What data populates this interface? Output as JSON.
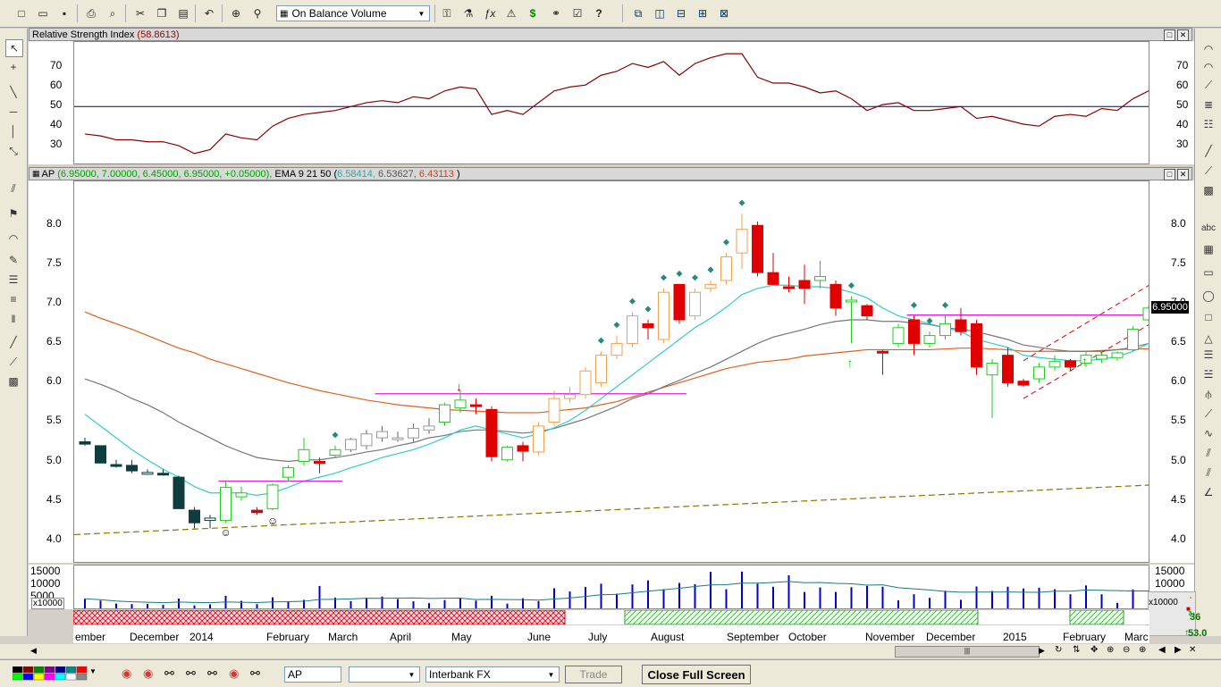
{
  "toolbar": {
    "indicator_select": "On Balance Volume"
  },
  "rsi_pane": {
    "title": "Relative Strength Index",
    "value": "(58.8613)",
    "yticks": [
      "70",
      "60",
      "50",
      "40",
      "30"
    ]
  },
  "price_pane": {
    "symbol": "AP",
    "ohlc": "(6.95000, 7.00000, 6.45000, 6.95000, +0.05000),",
    "ema_label": "EMA 9 21 50",
    "ema_open": "(",
    "ema_val1": "6.58414,",
    "ema_val2": "6.53627,",
    "ema_val3": "6.43113",
    "ema_close": ")",
    "yticks": [
      "8.0",
      "7.5",
      "7.0",
      "6.5",
      "6.0",
      "5.5",
      "5.0",
      "4.5",
      "4.0"
    ],
    "last_price": "6.95000"
  },
  "volume_pane": {
    "yticks": [
      "15000",
      "10000",
      "5000"
    ],
    "multiplier": "x10000",
    "right_multiplier": "x10000",
    "count_a": "36",
    "count_b": "53.0"
  },
  "timeline": {
    "months": [
      "ember",
      "December",
      "2014",
      "February",
      "March",
      "April",
      "May",
      "June",
      "July",
      "August",
      "September",
      "October",
      "November",
      "December",
      "2015",
      "February",
      "Marc"
    ]
  },
  "bottom": {
    "symbol_field": "AP",
    "broker_select": "Interbank FX",
    "trade_label": "Trade",
    "close_full_label": "Close Full Screen"
  },
  "colors": {
    "bull": "#22cc22",
    "bear_red": "#e00000",
    "bear_dark": "#0f3d3d",
    "orange": "#f0a050",
    "ema9": "#33cccc",
    "ema21": "#777777",
    "ema50": "#e06020",
    "rsi": "#8b0000",
    "volume": "#0000cc"
  },
  "chart_data": {
    "type": "candlestick",
    "ohlc": [
      [
        5.25,
        5.3,
        5.2,
        5.22
      ],
      [
        5.2,
        5.2,
        4.98,
        4.98
      ],
      [
        4.96,
        5.02,
        4.92,
        4.95
      ],
      [
        4.95,
        5.02,
        4.85,
        4.88
      ],
      [
        4.86,
        4.9,
        4.83,
        4.86
      ],
      [
        4.85,
        4.9,
        4.82,
        4.83
      ],
      [
        4.8,
        4.82,
        4.4,
        4.4
      ],
      [
        4.38,
        4.42,
        4.15,
        4.22
      ],
      [
        4.25,
        4.32,
        4.15,
        4.28
      ],
      [
        4.25,
        4.75,
        4.22,
        4.67
      ],
      [
        4.55,
        4.68,
        4.5,
        4.6
      ],
      [
        4.38,
        4.42,
        4.32,
        4.35
      ],
      [
        4.4,
        4.72,
        4.38,
        4.7
      ],
      [
        4.8,
        4.95,
        4.75,
        4.92
      ],
      [
        5.0,
        5.3,
        4.95,
        5.15
      ],
      [
        5.0,
        5.05,
        4.85,
        4.98
      ],
      [
        5.08,
        5.2,
        5.05,
        5.15
      ],
      [
        5.15,
        5.3,
        5.12,
        5.28
      ],
      [
        5.2,
        5.4,
        5.15,
        5.35
      ],
      [
        5.3,
        5.45,
        5.25,
        5.38
      ],
      [
        5.3,
        5.38,
        5.25,
        5.3
      ],
      [
        5.3,
        5.48,
        5.25,
        5.42
      ],
      [
        5.4,
        5.55,
        5.35,
        5.45
      ],
      [
        5.5,
        5.75,
        5.45,
        5.72
      ],
      [
        5.68,
        5.9,
        5.62,
        5.78
      ],
      [
        5.72,
        5.8,
        5.6,
        5.7
      ],
      [
        5.66,
        5.7,
        5.0,
        5.06
      ],
      [
        5.02,
        5.2,
        5.0,
        5.18
      ],
      [
        5.2,
        5.25,
        5.0,
        5.13
      ],
      [
        5.12,
        5.5,
        5.08,
        5.45
      ],
      [
        5.5,
        5.9,
        5.45,
        5.8
      ],
      [
        5.8,
        5.95,
        5.75,
        5.85
      ],
      [
        5.85,
        6.2,
        5.8,
        6.15
      ],
      [
        6.0,
        6.4,
        5.95,
        6.35
      ],
      [
        6.35,
        6.6,
        6.3,
        6.5
      ],
      [
        6.5,
        6.9,
        6.45,
        6.85
      ],
      [
        6.75,
        6.8,
        6.55,
        6.7
      ],
      [
        6.55,
        7.2,
        6.5,
        7.15
      ],
      [
        7.25,
        7.25,
        6.75,
        6.8
      ],
      [
        6.85,
        7.2,
        6.8,
        7.15
      ],
      [
        7.2,
        7.3,
        7.15,
        7.25
      ],
      [
        7.3,
        7.65,
        7.25,
        7.6
      ],
      [
        7.65,
        8.15,
        7.45,
        7.95
      ],
      [
        8.0,
        8.05,
        7.35,
        7.4
      ],
      [
        7.4,
        7.65,
        7.3,
        7.25
      ],
      [
        7.22,
        7.35,
        7.15,
        7.2
      ],
      [
        7.3,
        7.5,
        7.0,
        7.2
      ],
      [
        7.3,
        7.55,
        7.2,
        7.35
      ],
      [
        7.25,
        7.3,
        6.85,
        6.95
      ],
      [
        7.05,
        7.1,
        6.5,
        7.05
      ],
      [
        6.98,
        7.0,
        6.8,
        6.85
      ],
      [
        6.4,
        6.42,
        6.1,
        6.38
      ],
      [
        6.5,
        6.75,
        6.45,
        6.7
      ],
      [
        6.8,
        6.85,
        6.35,
        6.5
      ],
      [
        6.5,
        6.65,
        6.45,
        6.6
      ],
      [
        6.6,
        6.85,
        6.55,
        6.75
      ],
      [
        6.8,
        6.95,
        6.6,
        6.65
      ],
      [
        6.75,
        6.8,
        6.1,
        6.2
      ],
      [
        6.1,
        6.3,
        5.55,
        6.25
      ],
      [
        6.35,
        6.45,
        5.95,
        6.0
      ],
      [
        6.02,
        6.05,
        5.95,
        5.97
      ],
      [
        6.05,
        6.25,
        6.0,
        6.2
      ],
      [
        6.2,
        6.35,
        6.15,
        6.27
      ],
      [
        6.28,
        6.3,
        6.15,
        6.2
      ],
      [
        6.25,
        6.4,
        6.2,
        6.35
      ],
      [
        6.3,
        6.4,
        6.25,
        6.35
      ],
      [
        6.32,
        6.4,
        6.28,
        6.38
      ],
      [
        6.42,
        6.72,
        6.4,
        6.68
      ],
      [
        6.8,
        6.98,
        6.78,
        6.95
      ],
      [
        6.5,
        7.0,
        6.45,
        6.95
      ]
    ],
    "ema9": [
      5.6,
      5.45,
      5.3,
      5.15,
      5.02,
      4.9,
      4.8,
      4.68,
      4.6,
      4.6,
      4.6,
      4.57,
      4.6,
      4.67,
      4.75,
      4.8,
      4.85,
      4.92,
      4.98,
      5.05,
      5.1,
      5.15,
      5.22,
      5.3,
      5.4,
      5.45,
      5.4,
      5.35,
      5.3,
      5.35,
      5.43,
      5.52,
      5.65,
      5.8,
      5.95,
      6.1,
      6.25,
      6.4,
      6.55,
      6.7,
      6.82,
      6.96,
      7.12,
      7.2,
      7.24,
      7.24,
      7.22,
      7.22,
      7.2,
      7.15,
      7.08,
      6.95,
      6.85,
      6.8,
      6.75,
      6.7,
      6.65,
      6.55,
      6.5,
      6.45,
      6.35,
      6.32,
      6.3,
      6.28,
      6.28,
      6.3,
      6.33,
      6.4,
      6.5,
      6.58
    ],
    "ema21": [
      6.05,
      5.98,
      5.9,
      5.8,
      5.72,
      5.62,
      5.5,
      5.4,
      5.3,
      5.2,
      5.12,
      5.05,
      5.02,
      5.0,
      5.02,
      5.02,
      5.05,
      5.08,
      5.12,
      5.15,
      5.2,
      5.24,
      5.3,
      5.33,
      5.38,
      5.4,
      5.4,
      5.38,
      5.36,
      5.38,
      5.42,
      5.48,
      5.54,
      5.62,
      5.7,
      5.8,
      5.86,
      5.95,
      6.03,
      6.12,
      6.2,
      6.3,
      6.4,
      6.5,
      6.58,
      6.63,
      6.68,
      6.74,
      6.78,
      6.8,
      6.8,
      6.78,
      6.78,
      6.76,
      6.74,
      6.7,
      6.68,
      6.65,
      6.6,
      6.55,
      6.48,
      6.45,
      6.42,
      6.4,
      6.4,
      6.4,
      6.42,
      6.45,
      6.5,
      6.54
    ],
    "ema50": [
      6.9,
      6.82,
      6.75,
      6.68,
      6.6,
      6.52,
      6.44,
      6.38,
      6.3,
      6.24,
      6.18,
      6.12,
      6.06,
      6.0,
      5.95,
      5.9,
      5.86,
      5.82,
      5.78,
      5.75,
      5.72,
      5.7,
      5.68,
      5.66,
      5.65,
      5.64,
      5.63,
      5.62,
      5.62,
      5.62,
      5.64,
      5.66,
      5.68,
      5.72,
      5.76,
      5.82,
      5.88,
      5.94,
      6.0,
      6.06,
      6.12,
      6.18,
      6.22,
      6.26,
      6.28,
      6.3,
      6.34,
      6.36,
      6.38,
      6.4,
      6.42,
      6.42,
      6.42,
      6.42,
      6.42,
      6.43,
      6.44,
      6.44,
      6.43,
      6.42,
      6.4,
      6.4,
      6.4,
      6.4,
      6.4,
      6.41,
      6.42,
      6.43,
      6.43,
      6.43
    ],
    "rsi": [
      36,
      35,
      33,
      33,
      32,
      32,
      30,
      26,
      28,
      36,
      34,
      33,
      40,
      44,
      46,
      47,
      48,
      50,
      52,
      53,
      52,
      55,
      54,
      58,
      60,
      59,
      46,
      48,
      46,
      52,
      58,
      60,
      61,
      66,
      68,
      72,
      70,
      73,
      66,
      72,
      75,
      77,
      77,
      65,
      62,
      62,
      60,
      57,
      58,
      54,
      48,
      51,
      52,
      48,
      48,
      49,
      50,
      44,
      45,
      43,
      41,
      40,
      45,
      46,
      45,
      49,
      48,
      54,
      58,
      58.86
    ],
    "volume": [
      4500,
      3800,
      2600,
      2400,
      2500,
      2100,
      4600,
      1900,
      2300,
      5700,
      3700,
      2400,
      5100,
      3300,
      4100,
      9600,
      5000,
      3600,
      4900,
      5400,
      4400,
      3500,
      2800,
      4000,
      4800,
      3800,
      5700,
      2600,
      4700,
      3600,
      8700,
      7400,
      9200,
      10500,
      6500,
      10200,
      11800,
      8300,
      10800,
      10300,
      15200,
      8300,
      15300,
      10500,
      9300,
      13800,
      7200,
      9000,
      7200,
      9100,
      9600,
      9300,
      3900,
      6300,
      4900,
      7700,
      4100,
      9400,
      7600,
      9300,
      8600,
      8900,
      8300,
      6300,
      9800,
      6300,
      2900,
      8200,
      7500,
      3000
    ],
    "resistance_lines": [
      [
        4.75,
        4.75
      ],
      [
        5.86,
        5.86
      ],
      [
        6.86,
        6.86
      ]
    ],
    "rsi_level": 50
  }
}
